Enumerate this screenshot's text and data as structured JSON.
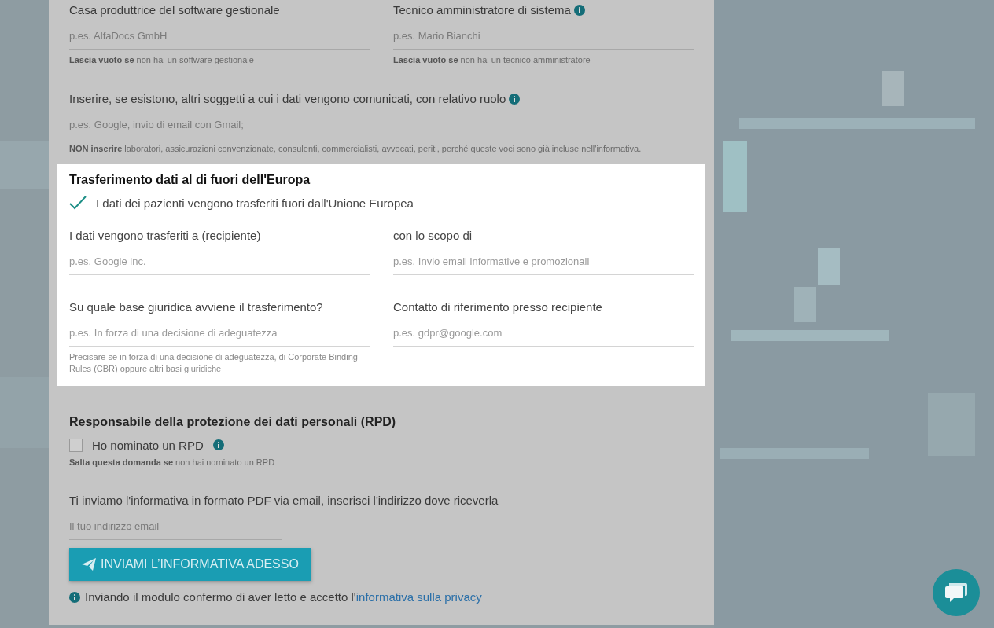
{
  "top_fields": [
    {
      "label": "Casa produttrice del software gestionale",
      "info": false,
      "placeholder": "p.es. AlfaDocs GmbH",
      "hint": "**Lascia vuoto se** non hai un software gestionale"
    },
    {
      "label": "Tecnico amministratore di sistema",
      "info": true,
      "placeholder": "p.es. Mario Bianchi",
      "hint": "**Lascia vuoto se** non hai un tecnico amministratore"
    }
  ],
  "others": {
    "label": "Inserire, se esistono, altri soggetti a cui i dati vengono comunicati, con relativo ruolo",
    "info": true,
    "placeholder": "p.es. Google, invio di email con Gmail;",
    "hint": "**NON inserire** laboratori, assicurazioni convenzionate, consulenti, commercialisti, avvocati, periti, perché queste voci sono già incluse nell'informativa."
  },
  "transfer": {
    "title": "Trasferimento dati al di fuori dell'Europa",
    "highlighted": true,
    "checkbox": {
      "label": "I dati dei pazienti vengono trasferiti fuori dall'Unione Europea",
      "checked": true,
      "info": false
    },
    "fields": [
      {
        "label": "I dati vengono trasferiti a (recipiente)",
        "info": false,
        "placeholder": "p.es. Google inc."
      },
      {
        "label": "con lo scopo di",
        "info": false,
        "placeholder": "p.es. Invio email informative e promozionali"
      },
      {
        "label": "Su quale base giuridica avviene il trasferimento?",
        "info": false,
        "placeholder": "p.es. In forza di una decisione di adeguatezza",
        "hint": "Precisare se in forza di una decisione di adeguatezza, di Corporate Binding Rules (CBR) oppure altri basi giuridiche"
      },
      {
        "label": "Contatto di riferimento presso recipiente",
        "info": false,
        "placeholder": "p.es. gdpr@google.com"
      }
    ]
  },
  "rpd": {
    "title": "Responsabile della protezione dei dati personali (RPD)",
    "highlighted": false,
    "checkbox": {
      "label": "Ho nominato un RPD",
      "checked": false,
      "info": true
    },
    "hint": "**Salta questa domanda se** non hai nominato un RPD"
  },
  "email": {
    "label": "Ti inviamo l'informativa in formato PDF via email, inserisci l'indirizzo dove riceverla",
    "placeholder": "Il tuo indirizzo email"
  },
  "submit": {
    "label": "INVIAMI L’INFORMATIVA ADESSO"
  },
  "consent": {
    "text": "Inviando il modulo confermo di aver letto e accetto l'",
    "link": "informativa sulla privacy"
  }
}
